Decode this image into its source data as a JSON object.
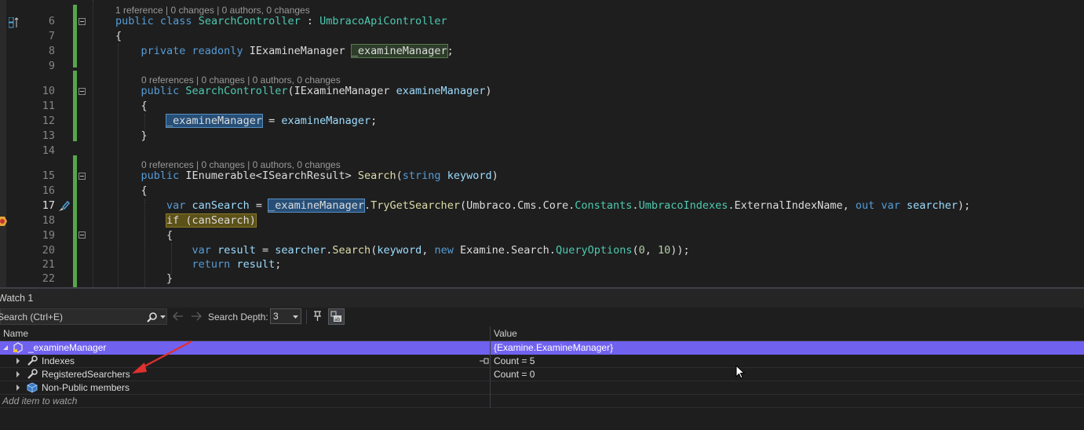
{
  "editor": {
    "code_lens": {
      "class": "1 reference | 0 changes | 0 authors, 0 changes",
      "ctor": "0 references | 0 changes | 0 authors, 0 changes",
      "search": "0 references | 0 changes | 0 authors, 0 changes"
    },
    "lines": [
      {
        "number": "6",
        "tokens": [
          [
            "public ",
            "kw"
          ],
          [
            "class ",
            "kw"
          ],
          [
            "SearchController",
            "ty"
          ],
          [
            " : ",
            ""
          ],
          [
            "UmbracoApiController",
            "ty"
          ]
        ]
      },
      {
        "number": "7",
        "tokens": [
          [
            "{",
            ""
          ]
        ]
      },
      {
        "number": "8",
        "tokens": [
          [
            "    private ",
            "kw"
          ],
          [
            "readonly ",
            "kw"
          ],
          [
            "IExamineManager ",
            ""
          ],
          [
            "_examineManager",
            "hlg"
          ],
          [
            ";",
            ""
          ]
        ]
      },
      {
        "number": "9",
        "tokens": []
      },
      {
        "number": "10",
        "tokens": [
          [
            "    public ",
            "kw"
          ],
          [
            "SearchController",
            "ty"
          ],
          [
            "(IExamineManager ",
            ""
          ],
          [
            "examineManager",
            "pm"
          ],
          [
            ")",
            ""
          ]
        ]
      },
      {
        "number": "11",
        "tokens": [
          [
            "    {",
            ""
          ]
        ]
      },
      {
        "number": "12",
        "tokens": [
          [
            "        ",
            ""
          ],
          [
            "_examineManager",
            "hl"
          ],
          [
            " = ",
            ""
          ],
          [
            "examineManager",
            "pm"
          ],
          [
            ";",
            ""
          ]
        ]
      },
      {
        "number": "13",
        "tokens": [
          [
            "    }",
            ""
          ]
        ]
      },
      {
        "number": "14",
        "tokens": []
      },
      {
        "number": "15",
        "tokens": [
          [
            "    public ",
            "kw"
          ],
          [
            "IEnumerable<ISearchResult> ",
            ""
          ],
          [
            "Search",
            "fn"
          ],
          [
            "(",
            ""
          ],
          [
            "string ",
            "kw"
          ],
          [
            "keyword",
            "pm"
          ],
          [
            ")",
            ""
          ]
        ]
      },
      {
        "number": "16",
        "tokens": [
          [
            "    {",
            ""
          ]
        ]
      },
      {
        "number": "17",
        "tokens": [
          [
            "        ",
            ""
          ],
          [
            "var ",
            "kw"
          ],
          [
            "canSearch",
            "pm"
          ],
          [
            " = ",
            ""
          ],
          [
            "_examineManager",
            "hl"
          ],
          [
            ".",
            ""
          ],
          [
            "TryGetSearcher",
            "fn"
          ],
          [
            "(Umbraco.Cms.Core.",
            ""
          ],
          [
            "Constants",
            "ty"
          ],
          [
            ".",
            ""
          ],
          [
            "UmbracoIndexes",
            "ty"
          ],
          [
            ".ExternalIndexName, ",
            ""
          ],
          [
            "out ",
            "kw"
          ],
          [
            "var ",
            "kw"
          ],
          [
            "searcher",
            "pm"
          ],
          [
            ");",
            ""
          ]
        ]
      },
      {
        "number": "18",
        "tokens": [
          [
            "        ",
            ""
          ],
          [
            "if (canSearch)",
            "hly"
          ]
        ]
      },
      {
        "number": "19",
        "tokens": [
          [
            "        {",
            ""
          ]
        ]
      },
      {
        "number": "20",
        "tokens": [
          [
            "            ",
            ""
          ],
          [
            "var ",
            "kw"
          ],
          [
            "result",
            "pm"
          ],
          [
            " = ",
            ""
          ],
          [
            "searcher",
            "pm"
          ],
          [
            ".",
            ""
          ],
          [
            "Search",
            "fn"
          ],
          [
            "(",
            ""
          ],
          [
            "keyword",
            "pm"
          ],
          [
            ", ",
            ""
          ],
          [
            "new ",
            "kw"
          ],
          [
            "Examine.Search.",
            ""
          ],
          [
            "QueryOptions",
            "ty"
          ],
          [
            "(",
            ""
          ],
          [
            "0",
            "nm"
          ],
          [
            ", ",
            ""
          ],
          [
            "10",
            "nm"
          ],
          [
            "));",
            ""
          ]
        ]
      },
      {
        "number": "21",
        "tokens": [
          [
            "            ",
            ""
          ],
          [
            "return ",
            "kw"
          ],
          [
            "result",
            "pm"
          ],
          [
            ";",
            ""
          ]
        ]
      },
      {
        "number": "22",
        "tokens": [
          [
            "        }",
            ""
          ]
        ]
      }
    ]
  },
  "watch": {
    "title": "Watch 1",
    "search_placeholder": "Search (Ctrl+E)",
    "depth_label": "Search Depth:",
    "depth_value": "3",
    "columns": {
      "name": "Name",
      "value": "Value"
    },
    "rows": [
      {
        "name": "_examineManager",
        "value": "{Examine.ExamineManager}",
        "icon": "object-icon",
        "expanded": true
      },
      {
        "name": "Indexes",
        "value": "Count = 5",
        "icon": "wrench-icon",
        "expanded": false
      },
      {
        "name": "RegisteredSearchers",
        "value": "Count = 0",
        "icon": "wrench-icon",
        "expanded": false
      },
      {
        "name": "Non-Public members",
        "value": "",
        "icon": "cube-icon",
        "expanded": false
      }
    ],
    "add_item": "Add item to watch"
  },
  "colors": {
    "selected_row": "#7161ef",
    "annotation_arrow": "#e03030",
    "change_bar": "#57a64a"
  }
}
